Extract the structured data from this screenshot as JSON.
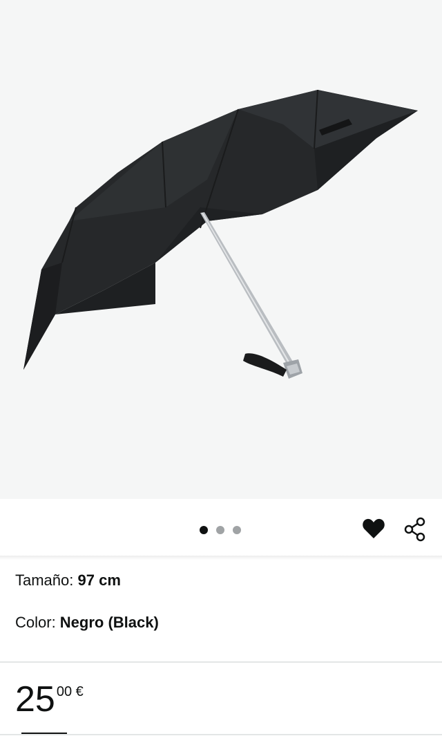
{
  "product": {
    "image_alt": "umbrella",
    "carousel": {
      "total": 3,
      "active_index": 0
    }
  },
  "actions": {
    "favorite_icon": "heart-icon",
    "share_icon": "share-icon"
  },
  "variants": {
    "size_label": "Tamaño: ",
    "size_value": "97 cm",
    "color_label": "Color: ",
    "color_value": "Negro (Black)"
  },
  "price": {
    "whole": "25",
    "fraction": "00 €"
  },
  "colors": {
    "image_background": "#f5f6f6",
    "text": "#0f1111",
    "dot_inactive": "#a0a3a5"
  }
}
